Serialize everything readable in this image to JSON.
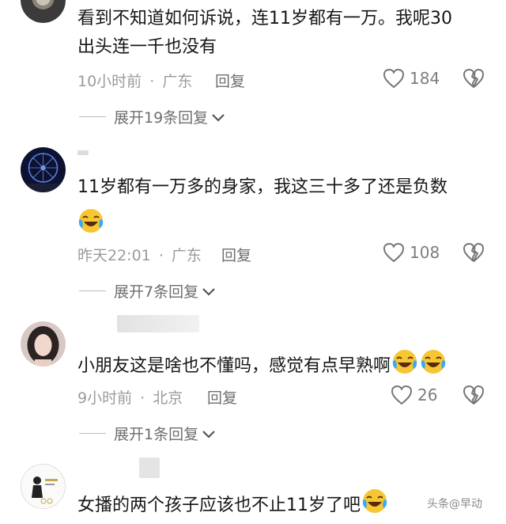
{
  "comments": [
    {
      "text_line1": "看到不知道如何诉说，连11岁都有一万。我呢30",
      "text_line2": "出头连一千也没有",
      "time": "10小时前",
      "location": "广东",
      "reply_label": "回复",
      "likes": "184",
      "expand": "展开19条回复"
    },
    {
      "text_line1": "11岁都有一万多的身家，我这三十多了还是负数",
      "time": "昨天22:01",
      "location": "广东",
      "reply_label": "回复",
      "likes": "108",
      "expand": "展开7条回复"
    },
    {
      "text_line1": "小朋友这是啥也不懂吗，感觉有点早熟啊",
      "time": "9小时前",
      "location": "北京",
      "reply_label": "回复",
      "likes": "26",
      "expand": "展开1条回复"
    },
    {
      "text_line1": "女播的两个孩子应该也不止11岁了吧"
    }
  ],
  "meta_separator": "·",
  "corner_text": "头条@早动",
  "icons": {
    "like": "heart-outline-icon",
    "dislike": "broken-heart-icon",
    "expand": "chevron-down-icon",
    "emoji": "laughing-tears-emoji-icon"
  }
}
